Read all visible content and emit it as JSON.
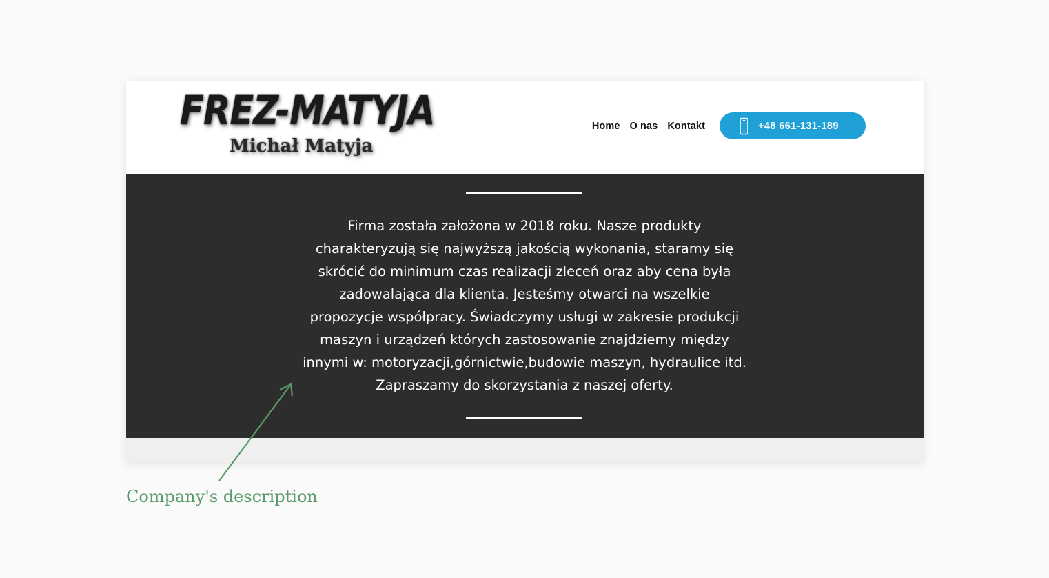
{
  "header": {
    "logo": {
      "main": "FREZ-MATYJA",
      "sub": "Michał Matyja"
    },
    "nav": [
      {
        "label": "Home"
      },
      {
        "label": "O nas"
      },
      {
        "label": "Kontakt"
      }
    ],
    "phone": {
      "icon": "mobile-phone-icon",
      "number": "+48 661-131-189",
      "color": "#1fa0d6"
    }
  },
  "about": {
    "background": "#2d2d2d",
    "lines": [
      "Firma została założona w 2018 roku. Nasze produkty",
      "charakteryzują się najwyższą jakością wykonania, staramy się",
      "skrócić do minimum czas realizacji zleceń oraz aby cena była",
      "zadowalająca dla klienta. Jesteśmy otwarci na wszelkie",
      "propozycje współpracy. Świadczymy usługi w zakresie produkcji",
      "maszyn i urządzeń których zastosowanie znajdziemy między",
      "innymi w: motoryzacji,górnictwie,budowie maszyn, hydraulice itd.",
      "Zapraszamy do skorzystania z naszej oferty."
    ]
  },
  "annotation": {
    "label": "Company's description",
    "color": "#5b9a6a"
  }
}
